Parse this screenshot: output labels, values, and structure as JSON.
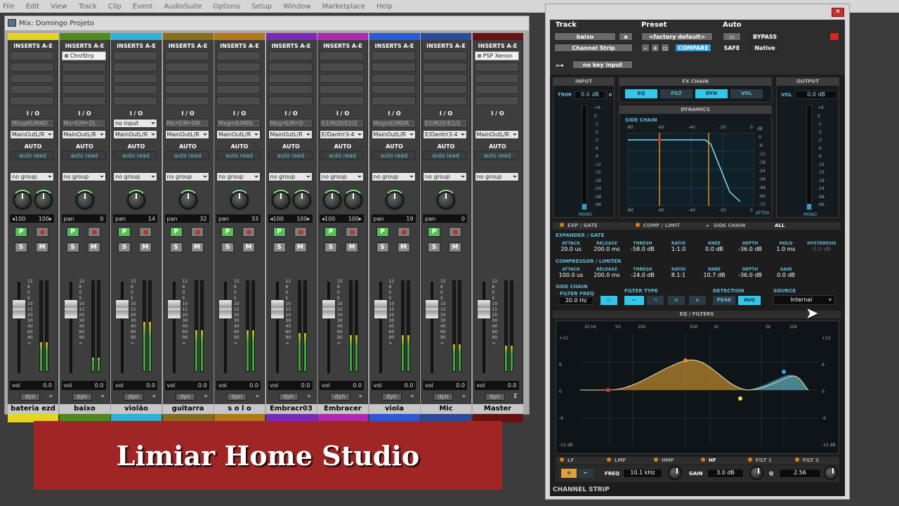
{
  "menubar": [
    "File",
    "Edit",
    "View",
    "Track",
    "Clip",
    "Event",
    "AudioSuite",
    "Options",
    "Setup",
    "Window",
    "Marketplace",
    "Help"
  ],
  "mix_window": {
    "title": "Mix: Domingo Projeto"
  },
  "mixer_labels": {
    "inserts": "INSERTS A-E",
    "io": "I / O",
    "auto": "AUTO",
    "auto_read": "auto read",
    "no_group": "no group",
    "vol": "vol",
    "dyn": "dyn",
    "pan": "pan",
    "p": "P",
    "s": "S",
    "m": "M"
  },
  "fader_scale": [
    "12",
    "6",
    "0",
    "5",
    "10",
    "15",
    "20",
    "30",
    "40",
    "60",
    "90",
    "∞"
  ],
  "channels": [
    {
      "name": "bateria ezd",
      "color": "#e6d420",
      "insert": "",
      "in": "MixgAE/MAD",
      "out": "MainOutL/R",
      "pan_l": "◂100",
      "pan_r": "100▸",
      "stereo": true,
      "vol": "0.0",
      "fader": 0.74,
      "meter": 0.32,
      "namebar": "#e6d420",
      "last_icon": "»"
    },
    {
      "name": "baixo",
      "color": "#4f8a1c",
      "insert": "ChnlStrp",
      "in": "Mx•E/M•DL",
      "out": "MainOutL/R",
      "pan_l": "pan",
      "pan_r": "0",
      "stereo": false,
      "vol": "0.0",
      "fader": 0.74,
      "meter": 0.15,
      "namebar": "#4f8a1c",
      "last_icon": "»"
    },
    {
      "name": "violão",
      "color": "#2eb0d8",
      "insert": "",
      "in": "no input",
      "out": "MainOutL/R",
      "pan_l": "pan",
      "pan_r": "14",
      "stereo": false,
      "vol": "0.0",
      "fader": 0.74,
      "meter": 0.55,
      "namebar": "#2eb0d8",
      "last_icon": "»"
    },
    {
      "name": "guitarra",
      "color": "#8a6d1a",
      "insert": "",
      "in": "Mx•E/M•DR",
      "out": "MainOutL/R",
      "pan_l": "pan",
      "pan_r": "32",
      "stereo": false,
      "vol": "0.0",
      "fader": 0.74,
      "meter": 0.45,
      "namebar": "#8a6d1a",
      "last_icon": "»"
    },
    {
      "name": "s o l o",
      "color": "#b07816",
      "insert": "",
      "in": "MxgmE/MDL",
      "out": "MainOutL/R",
      "pan_l": "pan",
      "pan_r": "33",
      "stereo": false,
      "vol": "0.0",
      "fader": 0.74,
      "meter": 0.45,
      "namebar": "#b07816",
      "last_icon": "»"
    },
    {
      "name": "Embracr03",
      "color": "#7a2ab8",
      "insert": "",
      "in": "Mxg•E/M•D",
      "out": "MainOutL/R",
      "pan_l": "◂100",
      "pan_r": "100▸",
      "stereo": true,
      "vol": "0.0",
      "fader": 0.74,
      "meter": 0.42,
      "namebar": "#7a2ab8",
      "last_icon": "»"
    },
    {
      "name": "Embracer",
      "color": "#b02ab0",
      "insert": "",
      "in": "E2/M2E/E2/2",
      "out": "E/Dantrr3-4",
      "pan_l": "◂100",
      "pan_r": "100▸",
      "stereo": true,
      "vol": "0.0",
      "fader": 0.74,
      "meter": 0.4,
      "namebar": "#b02ab0",
      "last_icon": "»"
    },
    {
      "name": "viola",
      "color": "#2a5ad8",
      "insert": "",
      "in": "MxgmE/MDR",
      "out": "MainOutL/R",
      "pan_l": "pan",
      "pan_r": "19",
      "stereo": false,
      "vol": "0.0",
      "fader": 0.74,
      "meter": 0.4,
      "namebar": "#2a5ad8",
      "last_icon": "»"
    },
    {
      "name": "Mic",
      "color": "#2a4a9a",
      "insert": "",
      "in": "E2/M2E/E2/2",
      "out": "E/Dantrr3-4",
      "pan_l": "pan",
      "pan_r": "0",
      "stereo": false,
      "vol": "0.0",
      "fader": 0.74,
      "meter": 0.3,
      "namebar": "#2a4a9a",
      "last_icon": "»"
    },
    {
      "name": "Master",
      "color": "#6a1010",
      "insert": "PSP Xenon",
      "in": "",
      "out": "MainOutL/R",
      "pan_l": "",
      "pan_r": "",
      "stereo": false,
      "vol": "0.0",
      "fader": 0.74,
      "meter": 0.28,
      "namebar": "#6a1010",
      "last_icon": "Σ"
    }
  ],
  "banner": {
    "text": "Limiar Home Studio"
  },
  "plugin": {
    "track_label": "Track",
    "preset_label": "Preset",
    "auto_label": "Auto",
    "track_name": "baixo",
    "track_letter": "a",
    "plugin_name": "Channel Strip",
    "preset_name": "<factory default>",
    "compare": "COMPARE",
    "bypass": "BYPASS",
    "safe": "SAFE",
    "native": "Native",
    "key_input": "no key input",
    "input": {
      "title": "INPUT",
      "trim_label": "TRIM",
      "trim_value": "0.0 dB",
      "mono": "MONO"
    },
    "output": {
      "title": "OUTPUT",
      "vol_label": "VOL",
      "vol_value": "0.0 dB",
      "mono": "MONO"
    },
    "meter_scale": [
      "+6",
      "0",
      "-1",
      "-2",
      "-3",
      "-6",
      "-9",
      "-12",
      "-15",
      "-18",
      "-24",
      "-48",
      "-96"
    ],
    "fx_chain": {
      "title": "FX CHAIN",
      "items": [
        "EQ",
        "FILT",
        "DYN",
        "VOL"
      ]
    },
    "dynamics": {
      "title": "DYNAMICS",
      "side_chain": "SIDE CHAIN",
      "top_scale": [
        "-80",
        "-60",
        "-40",
        "-20",
        "0"
      ],
      "db": "dB",
      "right_scale": [
        "0",
        "-6",
        "-12",
        "-18",
        "-24",
        "-36",
        "-48",
        "-60",
        "-72"
      ],
      "bottom_scale": [
        "-80",
        "-60",
        "-40",
        "-20",
        "0"
      ],
      "atten": "ATTEN"
    },
    "tabs": [
      "EXP / GATE",
      "COMP / LIMIT",
      "SIDE CHAIN",
      "ALL"
    ],
    "expander": {
      "title": "EXPANDER / GATE",
      "params": [
        {
          "label": "ATTACK",
          "value": "20.0 us"
        },
        {
          "label": "RELEASE",
          "value": "200.0 ms"
        },
        {
          "label": "THRESH",
          "value": "-58.0 dB"
        },
        {
          "label": "RATIO",
          "value": "1:1.0"
        },
        {
          "label": "KNEE",
          "value": "0.0 dB"
        },
        {
          "label": "DEPTH",
          "value": "-36.0 dB"
        },
        {
          "label": "HOLD",
          "value": "1.0 ms"
        },
        {
          "label": "HYSTERESIS",
          "value": "0.0 dB"
        }
      ]
    },
    "compressor": {
      "title": "COMPRESSOR / LIMITER",
      "params": [
        {
          "label": "ATTACK",
          "value": "100.0 us"
        },
        {
          "label": "RELEASE",
          "value": "200.0 ms"
        },
        {
          "label": "THRESH",
          "value": "-24.0 dB"
        },
        {
          "label": "RATIO",
          "value": "8.1:1"
        },
        {
          "label": "KNEE",
          "value": "10.7 dB"
        },
        {
          "label": "DEPTH",
          "value": "-36.0 dB"
        },
        {
          "label": "GAIN",
          "value": "0.0 dB"
        }
      ]
    },
    "sidechain": {
      "title": "SIDE CHAIN",
      "filter_freq_label": "FILTER FREQ",
      "filter_freq": "20.0 Hz",
      "filter_type": "FILTER TYPE",
      "detection": "DETECTION",
      "peak": "PEAK",
      "avg": "AVG",
      "source": "SOURCE",
      "source_value": "Internal"
    },
    "eq": {
      "title": "EQ / FILTERS",
      "freq_labels": [
        "20 Hz",
        "50",
        "100",
        "500",
        "1k",
        "5k",
        "10k"
      ],
      "left_scale": [
        "+12",
        "6",
        "0",
        "-6",
        "-12 dB"
      ],
      "right_scale": [
        "+12",
        "6",
        "0",
        "-6",
        "-12 dB"
      ],
      "bands": [
        "LF",
        "LMF",
        "HMF",
        "HF",
        "FILT 1",
        "FILT 2"
      ],
      "freq_label": "FREQ",
      "freq_value": "10.1 kHz",
      "gain_label": "GAIN",
      "gain_value": "3.0 dB",
      "q_label": "Q",
      "q_value": "2.56"
    },
    "footer": "CHANNEL STRIP"
  }
}
